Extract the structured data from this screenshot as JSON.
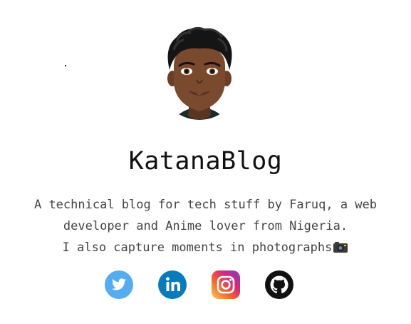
{
  "profile": {
    "name": "KatanaBlog",
    "bio_line1": "A technical blog for tech stuff by Faruq, a web",
    "bio_line2": "developer and Anime lover from Nigeria.",
    "bio_line3": "I also capture moments in photographs",
    "bio_icon": "camera-icon"
  },
  "socials": [
    {
      "name": "Twitter",
      "icon": "twitter-icon",
      "color": "#55ACEE"
    },
    {
      "name": "LinkedIn",
      "icon": "linkedin-icon",
      "color": "#0A7BBA"
    },
    {
      "name": "Instagram",
      "icon": "instagram-icon",
      "color": "#C13584"
    },
    {
      "name": "GitHub",
      "icon": "github-icon",
      "color": "#111111"
    }
  ]
}
